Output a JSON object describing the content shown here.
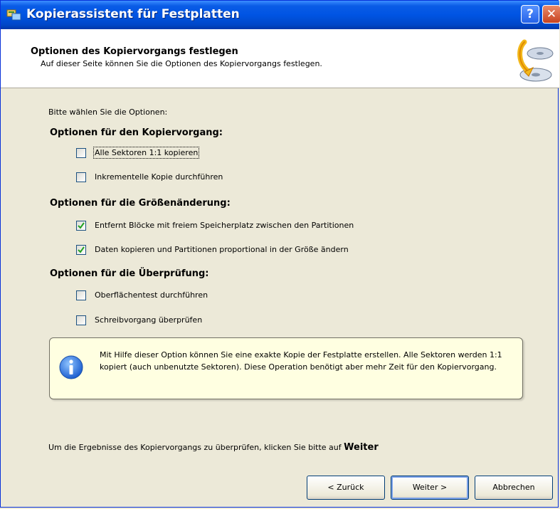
{
  "window": {
    "title": "Kopierassistent für Festplatten",
    "help_label": "?",
    "close_label": "✕"
  },
  "header": {
    "title": "Optionen des Kopiervorgangs festlegen",
    "subtitle": "Auf dieser Seite können Sie die Optionen des Kopiervorgangs festlegen."
  },
  "body": {
    "prompt": "Bitte wählen Sie die Optionen:",
    "groups": [
      {
        "title": "Optionen für den Kopiervorgang:",
        "options": [
          {
            "label": "Alle Sektoren 1:1 kopieren",
            "checked": false
          },
          {
            "label": "Inkrementelle Kopie durchführen",
            "checked": false
          }
        ]
      },
      {
        "title": "Optionen für die Größenänderung:",
        "options": [
          {
            "label": "Entfernt Blöcke mit freiem Speicherplatz zwischen den Partitionen",
            "checked": true
          },
          {
            "label": "Daten kopieren und Partitionen proportional in der Größe ändern",
            "checked": true
          }
        ]
      },
      {
        "title": "Optionen für die Überprüfung:",
        "options": [
          {
            "label": "Oberflächentest durchführen",
            "checked": false
          },
          {
            "label": "Schreibvorgang überprüfen",
            "checked": false
          }
        ]
      }
    ],
    "info": {
      "icon": "info-icon",
      "text": "Mit Hilfe dieser Option können Sie eine exakte Kopie der Festplatte erstellen. Alle Sektoren werden 1:1 kopiert (auch unbenutzte Sektoren). Diese Operation benötigt aber mehr Zeit für den Kopiervorgang."
    },
    "footer_text": "Um die Ergebnisse des Kopiervorgangs zu überprüfen, klicken Sie bitte auf",
    "footer_bold": "Weiter"
  },
  "buttons": {
    "back": "< Zurück",
    "next": "Weiter >",
    "cancel": "Abbrechen"
  },
  "colors": {
    "titlebar": "#0054e3",
    "dialog_bg": "#ece9d8",
    "info_bg": "#ffffe1",
    "check": "#21a121"
  }
}
